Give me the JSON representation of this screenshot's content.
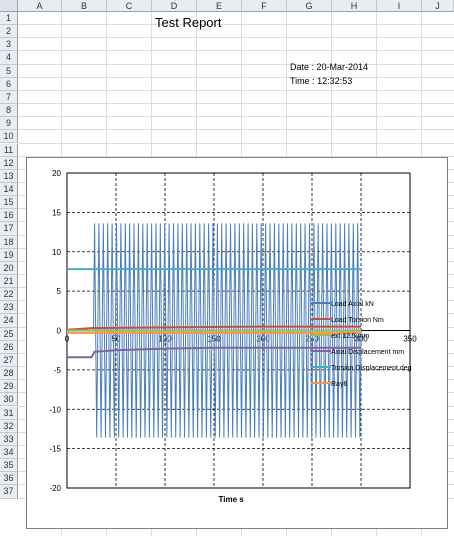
{
  "columns": [
    "A",
    "B",
    "C",
    "D",
    "E",
    "F",
    "G",
    "H",
    "I",
    "J"
  ],
  "rows": [
    "1",
    "2",
    "3",
    "4",
    "5",
    "6",
    "7",
    "8",
    "9",
    "10",
    "11",
    "12",
    "13",
    "14",
    "15",
    "16",
    "17",
    "18",
    "19",
    "20",
    "21",
    "22",
    "23",
    "24",
    "25",
    "26",
    "27",
    "28",
    "29",
    "30",
    "31",
    "32",
    "33",
    "34",
    "35",
    "36",
    "37"
  ],
  "report": {
    "title": "Test Report",
    "date": "Date : 20-Mar-2014",
    "time": "Time : 12:32:53"
  },
  "colors": {
    "header_bg": "#e9edf3",
    "grid": "#d9dde3",
    "load_axial": "#4a7eb9",
    "load_torsion": "#c0504d",
    "ext": "#9bbb59",
    "axial_disp": "#8064a2",
    "torsion_disp": "#4bacc6",
    "ray6": "#f79646"
  },
  "chart_data": {
    "type": "line",
    "xlabel": "Time  s",
    "ylabel": "",
    "xlim": [
      0,
      350
    ],
    "ylim": [
      -20,
      20
    ],
    "x_ticks": [
      0,
      50,
      100,
      150,
      200,
      250,
      300,
      350
    ],
    "y_ticks": [
      20,
      15,
      10,
      5,
      0,
      -5,
      -10,
      -15,
      -20
    ],
    "grid": true,
    "legend_position": "right",
    "series": [
      {
        "name": "Load Axial  kN",
        "color_key": "load_axial",
        "kind": "oscillation",
        "x_start": 0,
        "x_osc_start": 27,
        "x_end": 300,
        "cycles": 61,
        "amplitude": 13.6,
        "baseline": 0
      },
      {
        "name": "Load Torsion  Nm",
        "color_key": "load_torsion",
        "x": [
          0,
          25,
          100,
          200,
          300
        ],
        "values": [
          0.1,
          0.3,
          0.4,
          0.5,
          0.5
        ]
      },
      {
        "name": "ext 12.5  mm",
        "color_key": "ext",
        "x": [
          0,
          300
        ],
        "values": [
          0.0,
          0.0
        ]
      },
      {
        "name": "Axial Displacement  mm",
        "color_key": "axial_disp",
        "x": [
          0,
          25,
          28,
          50,
          100,
          150,
          200,
          250,
          300
        ],
        "values": [
          -3.4,
          -3.4,
          -2.7,
          -2.5,
          -2.3,
          -2.2,
          -2.2,
          -2.2,
          -2.2
        ]
      },
      {
        "name": "Torsion Displacement  deg",
        "color_key": "torsion_disp",
        "x": [
          0,
          300
        ],
        "values": [
          7.8,
          7.8
        ]
      },
      {
        "name": "Ray6",
        "color_key": "ray6",
        "x": [
          0,
          25,
          300
        ],
        "values": [
          -0.3,
          -0.3,
          -0.3
        ]
      }
    ]
  }
}
